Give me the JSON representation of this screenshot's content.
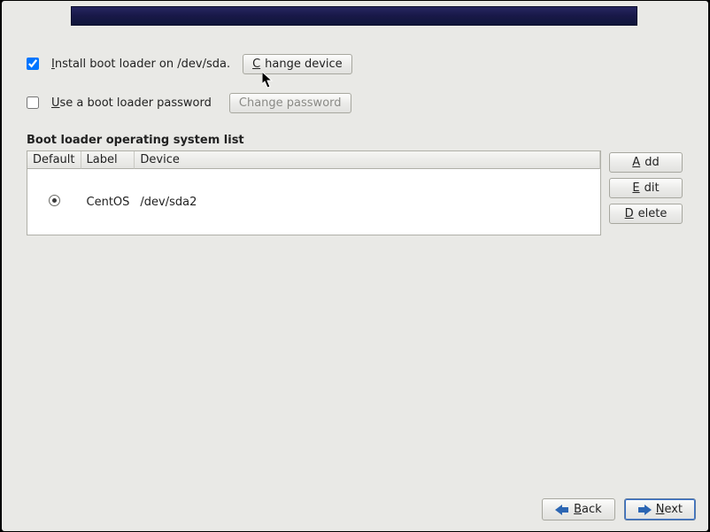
{
  "install": {
    "label_prefix": "I",
    "label_rest": "nstall boot loader on /dev/sda.",
    "checked": true,
    "change_device_prefix": "C",
    "change_device_rest": "hange device"
  },
  "password": {
    "label_prefix": "U",
    "label_rest": "se a boot loader password",
    "checked": false,
    "change_password": "Change password"
  },
  "section_title": "Boot loader operating system list",
  "table": {
    "headers": {
      "default": "Default",
      "label": "Label",
      "device": "Device"
    },
    "rows": [
      {
        "default": true,
        "label": "CentOS",
        "device": "/dev/sda2"
      }
    ]
  },
  "buttons": {
    "add_prefix": "A",
    "add_rest": "dd",
    "edit_prefix": "E",
    "edit_rest": "dit",
    "delete_prefix": "D",
    "delete_rest": "elete",
    "back_prefix": "B",
    "back_rest": "ack",
    "next_prefix": "N",
    "next_rest": "ext"
  }
}
